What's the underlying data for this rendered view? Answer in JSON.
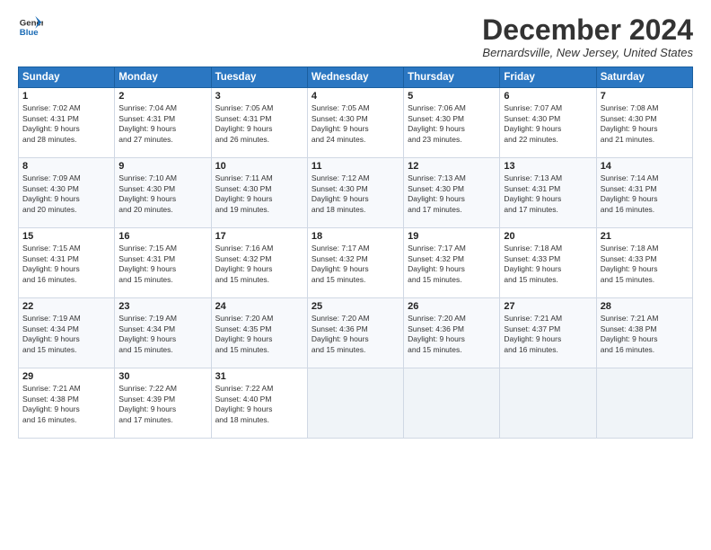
{
  "header": {
    "logo_line1": "General",
    "logo_line2": "Blue",
    "month": "December 2024",
    "location": "Bernardsville, New Jersey, United States"
  },
  "weekdays": [
    "Sunday",
    "Monday",
    "Tuesday",
    "Wednesday",
    "Thursday",
    "Friday",
    "Saturday"
  ],
  "weeks": [
    [
      {
        "day": 1,
        "lines": [
          "Sunrise: 7:02 AM",
          "Sunset: 4:31 PM",
          "Daylight: 9 hours",
          "and 28 minutes."
        ]
      },
      {
        "day": 2,
        "lines": [
          "Sunrise: 7:04 AM",
          "Sunset: 4:31 PM",
          "Daylight: 9 hours",
          "and 27 minutes."
        ]
      },
      {
        "day": 3,
        "lines": [
          "Sunrise: 7:05 AM",
          "Sunset: 4:31 PM",
          "Daylight: 9 hours",
          "and 26 minutes."
        ]
      },
      {
        "day": 4,
        "lines": [
          "Sunrise: 7:05 AM",
          "Sunset: 4:30 PM",
          "Daylight: 9 hours",
          "and 24 minutes."
        ]
      },
      {
        "day": 5,
        "lines": [
          "Sunrise: 7:06 AM",
          "Sunset: 4:30 PM",
          "Daylight: 9 hours",
          "and 23 minutes."
        ]
      },
      {
        "day": 6,
        "lines": [
          "Sunrise: 7:07 AM",
          "Sunset: 4:30 PM",
          "Daylight: 9 hours",
          "and 22 minutes."
        ]
      },
      {
        "day": 7,
        "lines": [
          "Sunrise: 7:08 AM",
          "Sunset: 4:30 PM",
          "Daylight: 9 hours",
          "and 21 minutes."
        ]
      }
    ],
    [
      {
        "day": 8,
        "lines": [
          "Sunrise: 7:09 AM",
          "Sunset: 4:30 PM",
          "Daylight: 9 hours",
          "and 20 minutes."
        ]
      },
      {
        "day": 9,
        "lines": [
          "Sunrise: 7:10 AM",
          "Sunset: 4:30 PM",
          "Daylight: 9 hours",
          "and 20 minutes."
        ]
      },
      {
        "day": 10,
        "lines": [
          "Sunrise: 7:11 AM",
          "Sunset: 4:30 PM",
          "Daylight: 9 hours",
          "and 19 minutes."
        ]
      },
      {
        "day": 11,
        "lines": [
          "Sunrise: 7:12 AM",
          "Sunset: 4:30 PM",
          "Daylight: 9 hours",
          "and 18 minutes."
        ]
      },
      {
        "day": 12,
        "lines": [
          "Sunrise: 7:13 AM",
          "Sunset: 4:30 PM",
          "Daylight: 9 hours",
          "and 17 minutes."
        ]
      },
      {
        "day": 13,
        "lines": [
          "Sunrise: 7:13 AM",
          "Sunset: 4:31 PM",
          "Daylight: 9 hours",
          "and 17 minutes."
        ]
      },
      {
        "day": 14,
        "lines": [
          "Sunrise: 7:14 AM",
          "Sunset: 4:31 PM",
          "Daylight: 9 hours",
          "and 16 minutes."
        ]
      }
    ],
    [
      {
        "day": 15,
        "lines": [
          "Sunrise: 7:15 AM",
          "Sunset: 4:31 PM",
          "Daylight: 9 hours",
          "and 16 minutes."
        ]
      },
      {
        "day": 16,
        "lines": [
          "Sunrise: 7:15 AM",
          "Sunset: 4:31 PM",
          "Daylight: 9 hours",
          "and 15 minutes."
        ]
      },
      {
        "day": 17,
        "lines": [
          "Sunrise: 7:16 AM",
          "Sunset: 4:32 PM",
          "Daylight: 9 hours",
          "and 15 minutes."
        ]
      },
      {
        "day": 18,
        "lines": [
          "Sunrise: 7:17 AM",
          "Sunset: 4:32 PM",
          "Daylight: 9 hours",
          "and 15 minutes."
        ]
      },
      {
        "day": 19,
        "lines": [
          "Sunrise: 7:17 AM",
          "Sunset: 4:32 PM",
          "Daylight: 9 hours",
          "and 15 minutes."
        ]
      },
      {
        "day": 20,
        "lines": [
          "Sunrise: 7:18 AM",
          "Sunset: 4:33 PM",
          "Daylight: 9 hours",
          "and 15 minutes."
        ]
      },
      {
        "day": 21,
        "lines": [
          "Sunrise: 7:18 AM",
          "Sunset: 4:33 PM",
          "Daylight: 9 hours",
          "and 15 minutes."
        ]
      }
    ],
    [
      {
        "day": 22,
        "lines": [
          "Sunrise: 7:19 AM",
          "Sunset: 4:34 PM",
          "Daylight: 9 hours",
          "and 15 minutes."
        ]
      },
      {
        "day": 23,
        "lines": [
          "Sunrise: 7:19 AM",
          "Sunset: 4:34 PM",
          "Daylight: 9 hours",
          "and 15 minutes."
        ]
      },
      {
        "day": 24,
        "lines": [
          "Sunrise: 7:20 AM",
          "Sunset: 4:35 PM",
          "Daylight: 9 hours",
          "and 15 minutes."
        ]
      },
      {
        "day": 25,
        "lines": [
          "Sunrise: 7:20 AM",
          "Sunset: 4:36 PM",
          "Daylight: 9 hours",
          "and 15 minutes."
        ]
      },
      {
        "day": 26,
        "lines": [
          "Sunrise: 7:20 AM",
          "Sunset: 4:36 PM",
          "Daylight: 9 hours",
          "and 15 minutes."
        ]
      },
      {
        "day": 27,
        "lines": [
          "Sunrise: 7:21 AM",
          "Sunset: 4:37 PM",
          "Daylight: 9 hours",
          "and 16 minutes."
        ]
      },
      {
        "day": 28,
        "lines": [
          "Sunrise: 7:21 AM",
          "Sunset: 4:38 PM",
          "Daylight: 9 hours",
          "and 16 minutes."
        ]
      }
    ],
    [
      {
        "day": 29,
        "lines": [
          "Sunrise: 7:21 AM",
          "Sunset: 4:38 PM",
          "Daylight: 9 hours",
          "and 16 minutes."
        ]
      },
      {
        "day": 30,
        "lines": [
          "Sunrise: 7:22 AM",
          "Sunset: 4:39 PM",
          "Daylight: 9 hours",
          "and 17 minutes."
        ]
      },
      {
        "day": 31,
        "lines": [
          "Sunrise: 7:22 AM",
          "Sunset: 4:40 PM",
          "Daylight: 9 hours",
          "and 18 minutes."
        ]
      },
      null,
      null,
      null,
      null
    ]
  ]
}
